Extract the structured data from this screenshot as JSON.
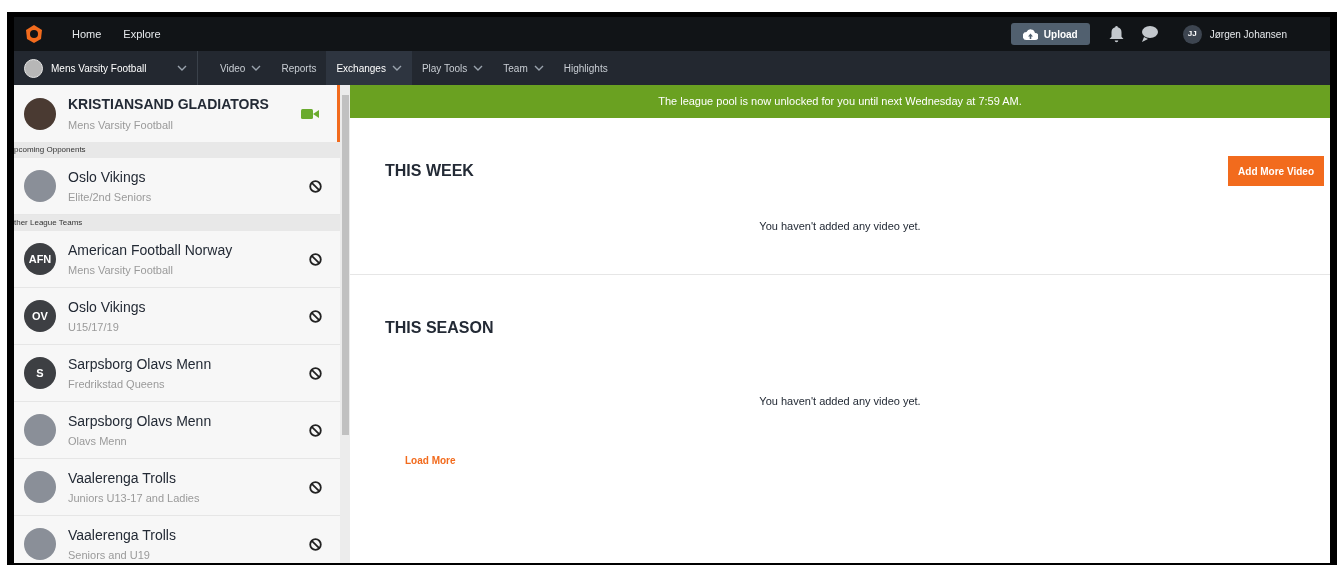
{
  "top_nav": {
    "links": [
      "Home",
      "Explore"
    ],
    "upload_button": "Upload",
    "user": {
      "initials": "JJ",
      "name": "Jørgen Johansen"
    }
  },
  "sub_nav": {
    "team_selector": "Mens Varsity Football",
    "tabs": [
      {
        "label": "Video",
        "dropdown": true,
        "selected": false
      },
      {
        "label": "Reports",
        "dropdown": false,
        "selected": false
      },
      {
        "label": "Exchanges",
        "dropdown": true,
        "selected": true
      },
      {
        "label": "Play Tools",
        "dropdown": true,
        "selected": false
      },
      {
        "label": "Team",
        "dropdown": true,
        "selected": false
      },
      {
        "label": "Highlights",
        "dropdown": false,
        "selected": false
      }
    ]
  },
  "sidebar": {
    "current_team": {
      "name": "KRISTIANSAND GLADIATORS",
      "subtitle": "Mens Varsity Football"
    },
    "sections": [
      {
        "title": "pcoming Opponents",
        "teams": [
          {
            "name": "Oslo Vikings",
            "subtitle": "Elite/2nd Seniors",
            "avatar": {
              "kind": "photo"
            }
          }
        ]
      },
      {
        "title": "ther League Teams",
        "teams": [
          {
            "name": "American Football Norway",
            "subtitle": "Mens Varsity Football",
            "avatar": {
              "kind": "initials",
              "text": "AFN"
            }
          },
          {
            "name": "Oslo Vikings",
            "subtitle": "U15/17/19",
            "avatar": {
              "kind": "initials",
              "text": "OV"
            }
          },
          {
            "name": "Sarpsborg Olavs Menn",
            "subtitle": "Fredrikstad Queens",
            "avatar": {
              "kind": "initials",
              "text": "S"
            }
          },
          {
            "name": "Sarpsborg Olavs Menn",
            "subtitle": "Olavs Menn",
            "avatar": {
              "kind": "photo"
            }
          },
          {
            "name": "Vaalerenga Trolls",
            "subtitle": "Juniors U13-17 and Ladies",
            "avatar": {
              "kind": "photo"
            }
          },
          {
            "name": "Vaalerenga Trolls",
            "subtitle": "Seniors and U19",
            "avatar": {
              "kind": "photo"
            }
          }
        ]
      }
    ]
  },
  "banner": "The league pool is now unlocked for you until next Wednesday at 7:59 AM.",
  "this_week": {
    "title": "THIS WEEK",
    "button": "Add More Video",
    "empty_message": "You haven't added any video yet."
  },
  "this_season": {
    "title": "THIS SEASON",
    "empty_message": "You haven't added any video yet.",
    "load_more": "Load More"
  }
}
